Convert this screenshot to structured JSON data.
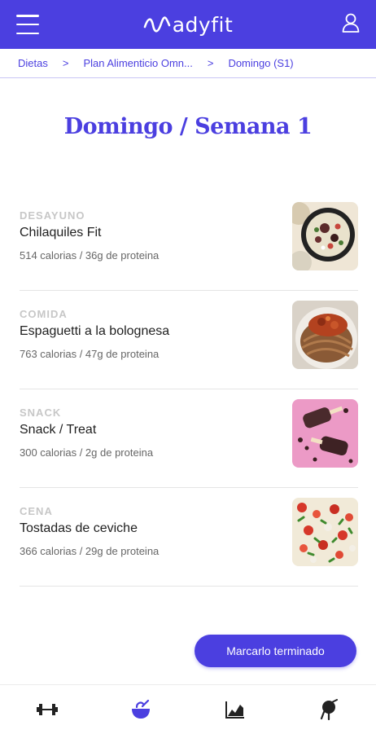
{
  "app": {
    "logo_text": "adyfit",
    "brand_color": "#4b3fe0"
  },
  "header": {
    "menu_icon": "hamburger-icon",
    "user_icon": "user-icon"
  },
  "breadcrumb": {
    "items": [
      "Dietas",
      "Plan Alimenticio Omn...",
      "Domingo (S1)"
    ],
    "separator": ">"
  },
  "page": {
    "title": "Domingo / Semana 1"
  },
  "meals": [
    {
      "type": "DESAYUNO",
      "name": "Chilaquiles Fit",
      "info": "514 calorias / 36g de proteina",
      "image": "chilaquiles-photo"
    },
    {
      "type": "COMIDA",
      "name": "Espaguetti a la bolognesa",
      "info": "763 calorias / 47g de proteina",
      "image": "spaghetti-photo"
    },
    {
      "type": "SNACK",
      "name": "Snack / Treat",
      "info": "300 calorias / 2g de proteina",
      "image": "chocolate-popsicle-photo"
    },
    {
      "type": "CENA",
      "name": "Tostadas de ceviche",
      "info": "366 calorias / 29g de proteina",
      "image": "ceviche-photo"
    }
  ],
  "actions": {
    "mark_done_label": "Marcarlo terminado"
  },
  "bottom_nav": {
    "items": [
      "dumbbell-icon",
      "bowl-icon",
      "chart-icon",
      "measure-icon"
    ],
    "active_index": 1
  }
}
